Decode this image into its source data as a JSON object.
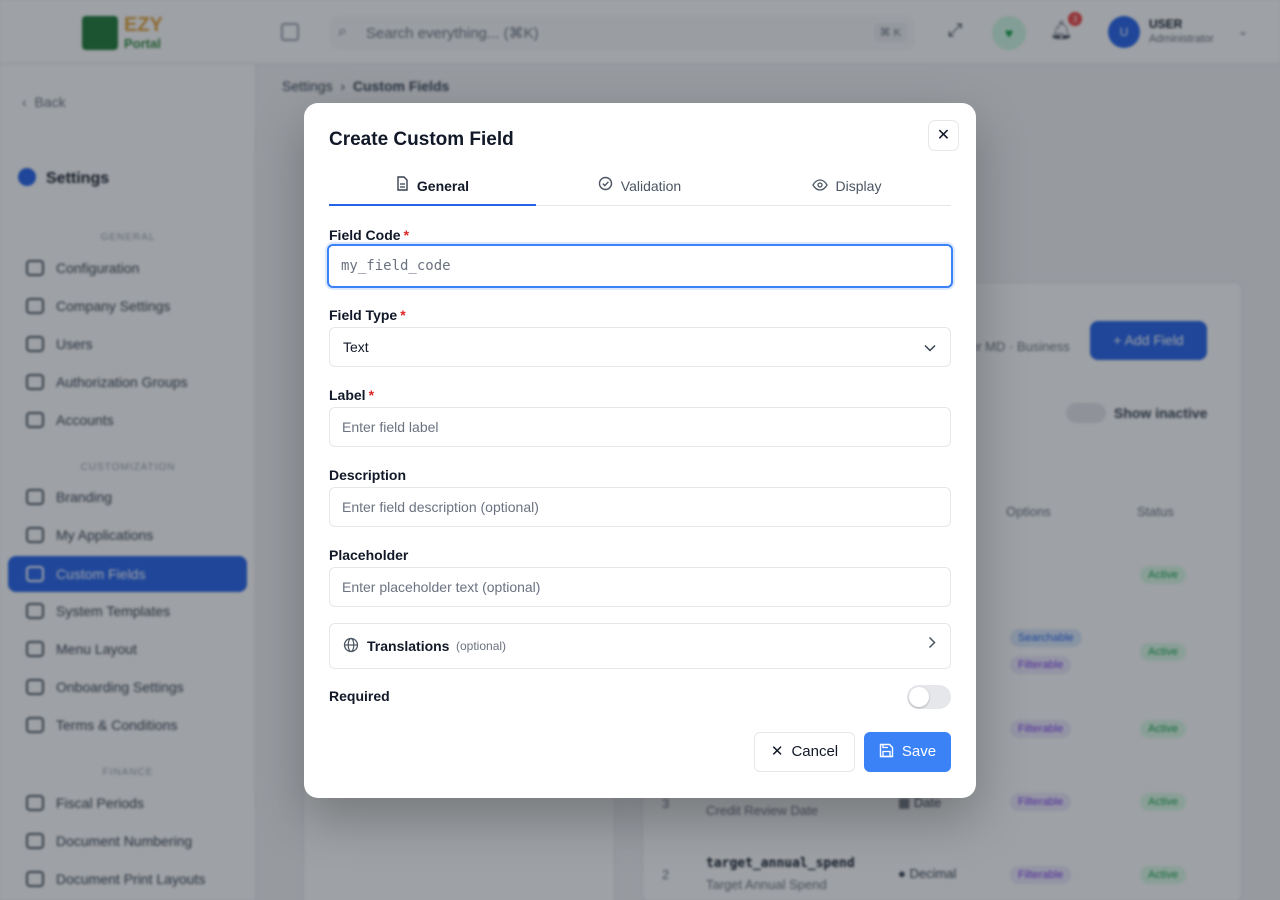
{
  "topbar": {
    "logo_text": "EZY",
    "logo_sub": "Portal",
    "search_placeholder": "Search everything... (⌘K)",
    "search_shortcut": "⌘ K",
    "notification_count": "3",
    "user_initials": "U",
    "user_name": "USER",
    "user_role": "Administrator"
  },
  "sidebar": {
    "back_label": "Back",
    "title": "Settings",
    "sections": [
      {
        "label": "GENERAL",
        "items": [
          "Configuration",
          "Company Settings",
          "Users",
          "Authorization Groups",
          "Accounts"
        ]
      },
      {
        "label": "CUSTOMIZATION",
        "items": [
          "Branding",
          "My Applications",
          "Custom Fields",
          "System Templates",
          "Menu Layout",
          "Onboarding Settings",
          "Terms & Conditions"
        ]
      },
      {
        "label": "FINANCE",
        "items": [
          "Fiscal Periods",
          "Document Numbering",
          "Document Print Layouts"
        ]
      }
    ],
    "active_item": "Custom Fields"
  },
  "background": {
    "breadcrumb": [
      "Settings",
      "Custom Fields"
    ],
    "add_field_label": "+ Add Field",
    "show_inactive_label": "Show inactive",
    "meta_text": "er MD · Business",
    "columns": [
      "Options",
      "Status"
    ],
    "rows": [
      {
        "index": "3",
        "code": "",
        "sub": "Credit Review Date",
        "type": "Date",
        "options": [
          "Filterable"
        ],
        "status": "Active"
      },
      {
        "index": "2",
        "code": "target_annual_spend",
        "sub": "Target Annual Spend",
        "type": "Decimal",
        "options": [
          "Filterable"
        ],
        "status": "Active"
      }
    ],
    "other_pills": [
      "Searchable",
      "Filterable",
      "Filterable",
      "Active",
      "Active",
      "Active"
    ]
  },
  "modal": {
    "title": "Create Custom Field",
    "close_icon": "close-icon",
    "tabs": [
      {
        "label": "General",
        "icon": "document-icon",
        "active": true
      },
      {
        "label": "Validation",
        "icon": "check-circle-icon",
        "active": false
      },
      {
        "label": "Display",
        "icon": "eye-icon",
        "active": false
      }
    ],
    "fields": {
      "field_code": {
        "label": "Field Code",
        "required_mark": "*",
        "value": "",
        "placeholder": "my_field_code"
      },
      "field_type": {
        "label": "Field Type",
        "required_mark": "*",
        "value": "Text"
      },
      "label": {
        "label": "Label",
        "required_mark": "*",
        "value": "",
        "placeholder": "Enter field label"
      },
      "description": {
        "label": "Description",
        "value": "",
        "placeholder": "Enter field description (optional)"
      },
      "placeholder": {
        "label": "Placeholder",
        "value": "",
        "placeholder": "Enter placeholder text (optional)"
      }
    },
    "translations": {
      "label": "Translations",
      "note": "(optional)"
    },
    "required": {
      "label": "Required",
      "on": false
    },
    "buttons": {
      "cancel": "Cancel",
      "save": "Save"
    },
    "accent_color": "#3b82f6",
    "required_color": "#dc2626"
  }
}
